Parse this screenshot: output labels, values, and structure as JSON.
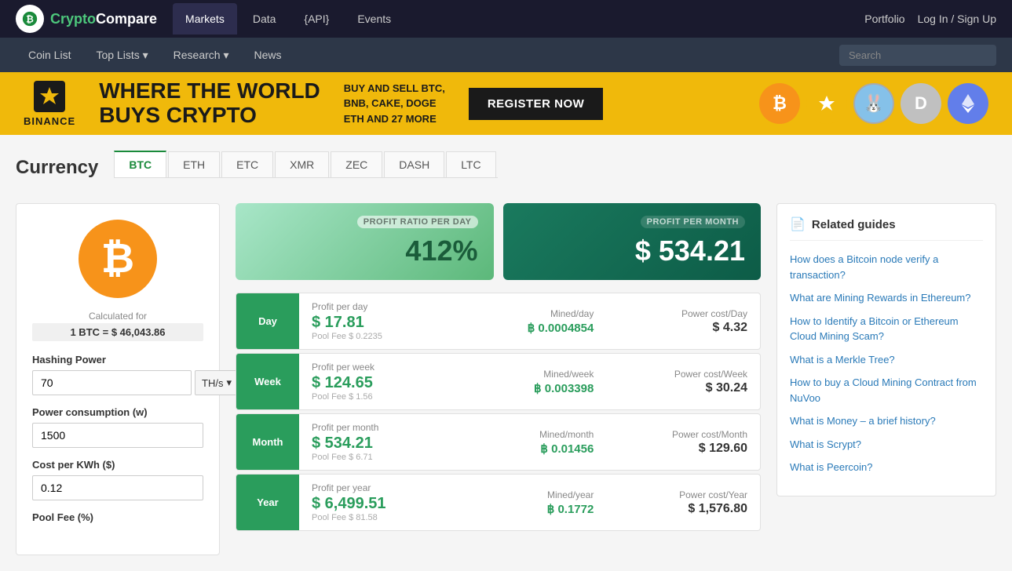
{
  "logo": {
    "text_crypto": "Crypto",
    "text_compare": "Compare",
    "icon": "₿"
  },
  "top_nav": {
    "links": [
      {
        "label": "Markets",
        "active": true
      },
      {
        "label": "Data",
        "active": false
      },
      {
        "label": "{API}",
        "active": false
      },
      {
        "label": "Events",
        "active": false
      }
    ],
    "right_links": [
      {
        "label": "Portfolio"
      },
      {
        "label": "Log In / Sign Up"
      }
    ]
  },
  "sec_nav": {
    "links": [
      {
        "label": "Coin List"
      },
      {
        "label": "Top Lists ▾"
      },
      {
        "label": "Research ▾"
      },
      {
        "label": "News"
      }
    ],
    "search_placeholder": "Search"
  },
  "banner": {
    "brand": "BINANCE",
    "headline_line1": "WHERE THE WORLD",
    "headline_line2": "BUYS CRYPTO",
    "description": "BUY AND SELL BTC,\nBNB, CAKE, DOGE\nETH AND 27 MORE",
    "cta": "REGISTER NOW"
  },
  "page": {
    "title": "Currency",
    "tabs": [
      {
        "label": "BTC",
        "active": true
      },
      {
        "label": "ETH",
        "active": false
      },
      {
        "label": "ETC",
        "active": false
      },
      {
        "label": "XMR",
        "active": false
      },
      {
        "label": "ZEC",
        "active": false
      },
      {
        "label": "DASH",
        "active": false
      },
      {
        "label": "LTC",
        "active": false
      }
    ]
  },
  "calculator": {
    "calculated_for": "Calculated for",
    "btc_price": "1 BTC = $ 46,043.86",
    "hashing_power_label": "Hashing Power",
    "hashing_power_value": "70",
    "hashing_power_unit": "TH/s",
    "power_consumption_label": "Power consumption (w)",
    "power_consumption_value": "1500",
    "cost_per_kwh_label": "Cost per KWh ($)",
    "cost_per_kwh_value": "0.12",
    "pool_fee_label": "Pool Fee (%)"
  },
  "profit_summary": {
    "day_label": "PROFIT RATIO PER DAY",
    "day_value": "412%",
    "month_label": "PROFIT PER MONTH",
    "month_value": "$ 534.21"
  },
  "profit_rows": [
    {
      "period": "Day",
      "profit_title": "Profit per day",
      "profit_amount": "$ 17.81",
      "pool_fee": "Pool Fee $ 0.2235",
      "mined_title": "Mined/day",
      "mined_value": "฿ 0.0004854",
      "cost_title": "Power cost/Day",
      "cost_value": "$ 4.32"
    },
    {
      "period": "Week",
      "profit_title": "Profit per week",
      "profit_amount": "$ 124.65",
      "pool_fee": "Pool Fee $ 1.56",
      "mined_title": "Mined/week",
      "mined_value": "฿ 0.003398",
      "cost_title": "Power cost/Week",
      "cost_value": "$ 30.24"
    },
    {
      "period": "Month",
      "profit_title": "Profit per month",
      "profit_amount": "$ 534.21",
      "pool_fee": "Pool Fee $ 6.71",
      "mined_title": "Mined/month",
      "mined_value": "฿ 0.01456",
      "cost_title": "Power cost/Month",
      "cost_value": "$ 129.60"
    },
    {
      "period": "Year",
      "profit_title": "Profit per year",
      "profit_amount": "$ 6,499.51",
      "pool_fee": "Pool Fee $ 81.58",
      "mined_title": "Mined/year",
      "mined_value": "฿ 0.1772",
      "cost_title": "Power cost/Year",
      "cost_value": "$ 1,576.80"
    }
  ],
  "related_guides": {
    "header": "Related guides",
    "guides": [
      {
        "text": "How does a Bitcoin node verify a transaction?",
        "link": true
      },
      {
        "text": "What are Mining Rewards in Ethereum?",
        "link": true
      },
      {
        "text": "How to Identify a Bitcoin or Ethereum Cloud Mining Scam?",
        "link": true
      },
      {
        "text": "What is a Merkle Tree?",
        "link": true
      },
      {
        "text": "How to buy a Cloud Mining Contract from NuVoo",
        "link": true
      },
      {
        "text": "What is Money – a brief history?",
        "link": true
      },
      {
        "text": "What is Scrypt?",
        "link": true
      },
      {
        "text": "What is Peercoin?",
        "link": true
      }
    ]
  }
}
